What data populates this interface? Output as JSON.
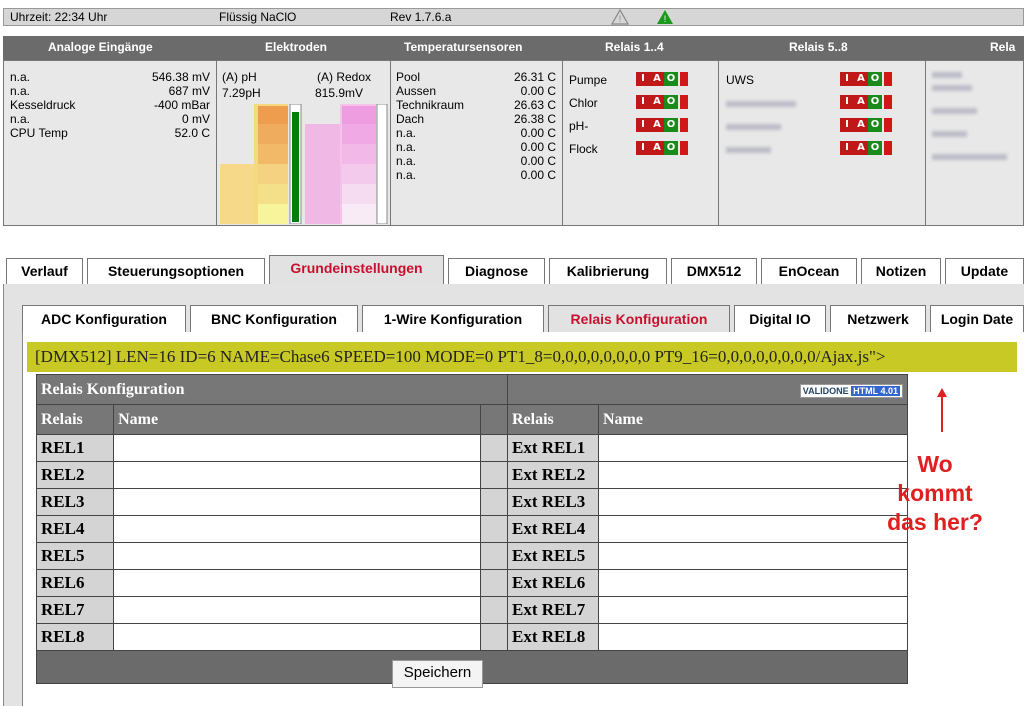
{
  "status": {
    "time": "Uhrzeit: 22:34 Uhr",
    "chemical": "Flüssig NaClO",
    "revision": "Rev 1.7.6.a"
  },
  "sections": [
    "Analoge Eingänge",
    "Elektroden",
    "Temperatursensoren",
    "Relais 1..4",
    "Relais 5..8",
    "Rela"
  ],
  "analog": [
    {
      "name": "n.a.",
      "value": "546.38 mV"
    },
    {
      "name": "n.a.",
      "value": "687 mV"
    },
    {
      "name": "Kesseldruck",
      "value": "-400 mBar"
    },
    {
      "name": "n.a.",
      "value": "0 mV"
    },
    {
      "name": "CPU Temp",
      "value": "52.0 C"
    }
  ],
  "electrodes": {
    "ph_label": "(A) pH",
    "ph_value": "7.29pH",
    "redox_label": "(A) Redox",
    "redox_value": "815.9mV"
  },
  "temperatures": [
    {
      "name": "Pool",
      "value": "26.31 C"
    },
    {
      "name": "Aussen",
      "value": "0.00 C"
    },
    {
      "name": "Technikraum",
      "value": "26.63 C"
    },
    {
      "name": "Dach",
      "value": "26.38 C"
    },
    {
      "name": "n.a.",
      "value": "0.00 C"
    },
    {
      "name": "n.a.",
      "value": "0.00 C"
    },
    {
      "name": "n.a.",
      "value": "0.00 C"
    },
    {
      "name": "n.a.",
      "value": "0.00 C"
    }
  ],
  "relays_1_4": [
    "Pumpe",
    "Chlor",
    "pH-",
    "Flock"
  ],
  "relays_5_8_first": "UWS",
  "switch": {
    "i": "I",
    "a": "A",
    "o": "O"
  },
  "tabs_main": [
    "Verlauf",
    "Steuerungsoptionen",
    "Grundeinstellungen",
    "Diagnose",
    "Kalibrierung",
    "DMX512",
    "EnOcean",
    "Notizen",
    "Update"
  ],
  "tabs_sub": [
    "ADC Konfiguration",
    "BNC Konfiguration",
    "1-Wire Konfiguration",
    "Relais Konfiguration",
    "Digital IO",
    "Netzwerk",
    "Login Date"
  ],
  "dmx_line": "[DMX512] LEN=16 ID=6 NAME=Chase6 SPEED=100 MODE=0 PT1_8=0,0,0,0,0,0,0,0 PT9_16=0,0,0,0,0,0,0,0/Ajax.js\">",
  "relay_config": {
    "title": "Relais Konfiguration",
    "badge_left": "VALIDONE",
    "badge_right": "HTML 4.01",
    "col_relais": "Relais",
    "col_name": "Name",
    "rows": [
      {
        "left": "REL1",
        "right": "Ext REL1"
      },
      {
        "left": "REL2",
        "right": "Ext REL2"
      },
      {
        "left": "REL3",
        "right": "Ext REL3"
      },
      {
        "left": "REL4",
        "right": "Ext REL4"
      },
      {
        "left": "REL5",
        "right": "Ext REL5"
      },
      {
        "left": "REL6",
        "right": "Ext REL6"
      },
      {
        "left": "REL7",
        "right": "Ext REL7"
      },
      {
        "left": "REL8",
        "right": "Ext REL8"
      }
    ],
    "save_label": "Speichern"
  },
  "annotation": [
    "Wo",
    "kommt",
    "das her?"
  ],
  "colors": {
    "active_tab": "#c8102e",
    "dmx_highlight": "#c9c926",
    "annotation": "#e02020"
  }
}
